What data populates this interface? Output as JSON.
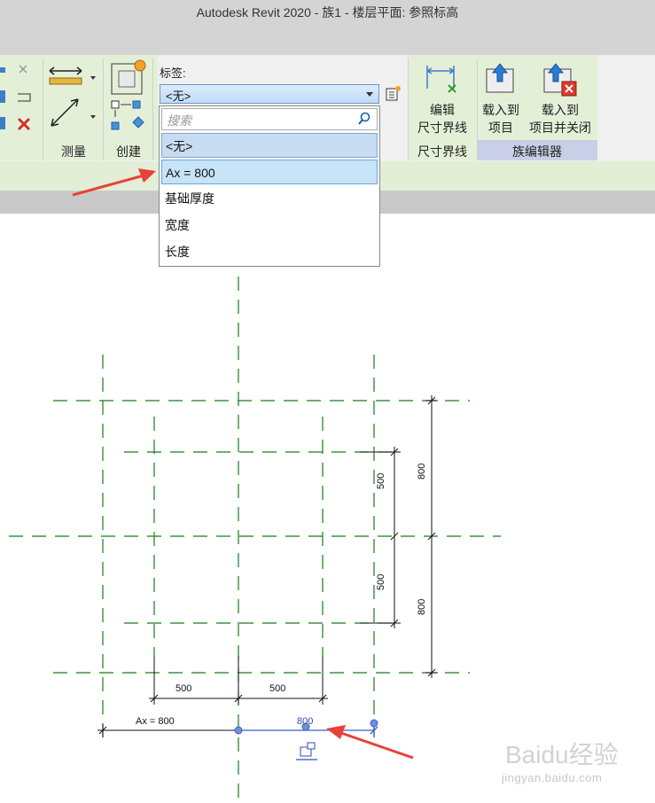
{
  "window": {
    "title": "Autodesk Revit 2020 - 族1 - 楼层平面: 参照标高"
  },
  "ribbon": {
    "panels": {
      "measure": "测量",
      "create": "创建",
      "dimension": "尺寸界线",
      "family_editor": "族编辑器"
    },
    "label_title": "标签:",
    "label_combo_value": "<无>",
    "edit_witness_lines": [
      "编辑",
      "尺寸界线"
    ],
    "load_into_project": [
      "载入到",
      "项目"
    ],
    "load_into_project_close": [
      "载入到",
      "项目并关闭"
    ]
  },
  "dropdown": {
    "search_placeholder": "搜索",
    "items": [
      "<无>",
      "Ax = 800",
      "基础厚度",
      "宽度",
      "长度"
    ]
  },
  "drawing": {
    "dim_horizontal": [
      "500",
      "500"
    ],
    "dim_vertical_inner": [
      "500",
      "500"
    ],
    "dim_vertical_outer": [
      "800",
      "800"
    ],
    "dim_ax_label": "Ax = 800",
    "dim_selected_value": "800"
  },
  "watermark": {
    "logo": "Baidu经验",
    "url": "jingyan.baidu.com"
  },
  "colors": {
    "ribbon_green": "#e4efd8",
    "family_panel": "#c9cfe6",
    "grid_line": "#1a7a1a",
    "selection": "#3a5fc8",
    "arrow_red": "#e8413a"
  }
}
